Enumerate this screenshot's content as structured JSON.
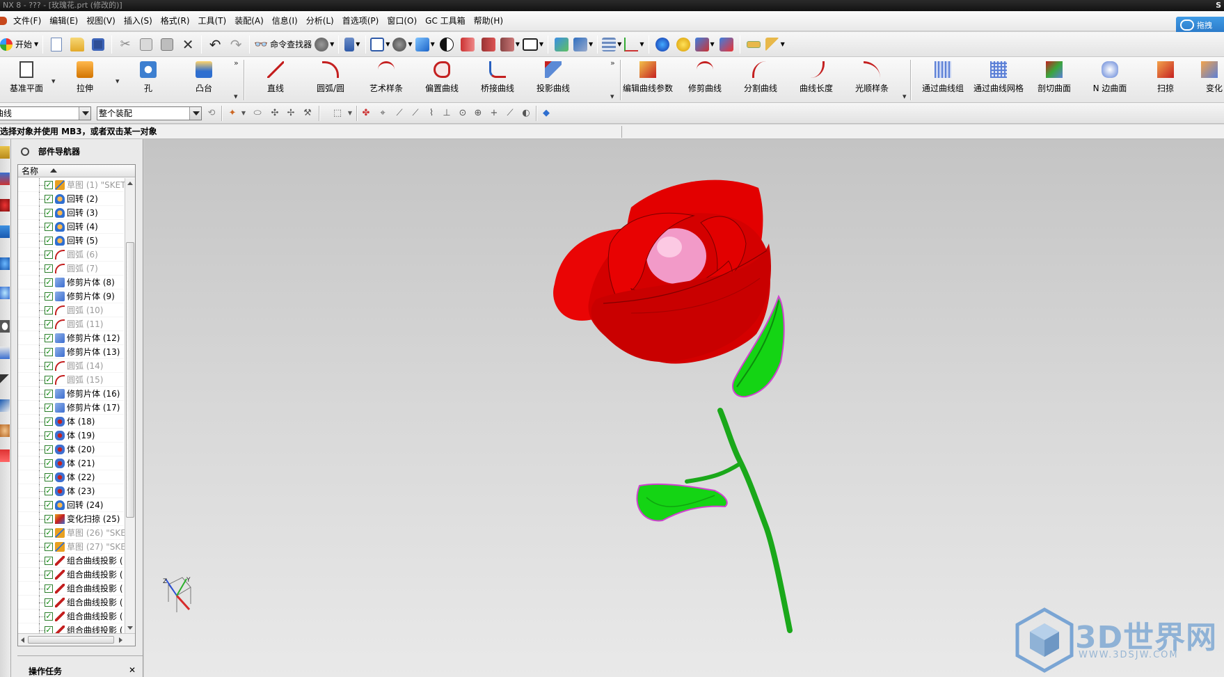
{
  "window": {
    "title": "NX 8 - ??? - [玫瑰花.prt (修改的)]",
    "corner_letter": "S"
  },
  "menubar": {
    "items": [
      {
        "label": "文件(F)"
      },
      {
        "label": "编辑(E)"
      },
      {
        "label": "视图(V)"
      },
      {
        "label": "插入(S)"
      },
      {
        "label": "格式(R)"
      },
      {
        "label": "工具(T)"
      },
      {
        "label": "装配(A)"
      },
      {
        "label": "信息(I)"
      },
      {
        "label": "分析(L)"
      },
      {
        "label": "首选项(P)"
      },
      {
        "label": "窗口(O)"
      },
      {
        "label": "GC 工具箱"
      },
      {
        "label": "帮助(H)"
      }
    ],
    "help_button": "拖拽"
  },
  "toolbar_standard": {
    "start_label": "开始",
    "command_finder_label": "命令查找器",
    "icons": [
      "new-file-icon",
      "open-folder-icon",
      "save-icon",
      "cut-icon",
      "copy-icon",
      "paste-icon",
      "delete-icon",
      "undo-icon",
      "redo-icon"
    ]
  },
  "toolbar_features": {
    "buttons": [
      {
        "label": "基准平面",
        "icon": "datum-plane-icon"
      },
      {
        "label": "拉伸",
        "icon": "extrude-icon"
      },
      {
        "label": "孔",
        "icon": "hole-icon"
      },
      {
        "label": "凸台",
        "icon": "boss-icon"
      },
      {
        "label": "直线",
        "icon": "line-icon"
      },
      {
        "label": "圆弧/圆",
        "icon": "arc-icon"
      },
      {
        "label": "艺术样条",
        "icon": "studio-spline-icon"
      },
      {
        "label": "偏置曲线",
        "icon": "offset-curve-icon"
      },
      {
        "label": "桥接曲线",
        "icon": "bridge-curve-icon"
      },
      {
        "label": "投影曲线",
        "icon": "project-curve-icon"
      },
      {
        "label": "编辑曲线参数",
        "icon": "edit-curve-params-icon"
      },
      {
        "label": "修剪曲线",
        "icon": "trim-curve-icon"
      },
      {
        "label": "分割曲线",
        "icon": "divide-curve-icon"
      },
      {
        "label": "曲线长度",
        "icon": "curve-length-icon"
      },
      {
        "label": "光顺样条",
        "icon": "fair-spline-icon"
      },
      {
        "label": "通过曲线组",
        "icon": "through-curves-icon"
      },
      {
        "label": "通过曲线网格",
        "icon": "through-curve-mesh-icon"
      },
      {
        "label": "剖切曲面",
        "icon": "section-surface-icon"
      },
      {
        "label": "N 边曲面",
        "icon": "n-sided-surface-icon"
      },
      {
        "label": "扫掠",
        "icon": "swept-icon"
      },
      {
        "label": "变化",
        "icon": "variational-sweep-icon"
      }
    ]
  },
  "selection_bar": {
    "filter_value": "曲线",
    "scope_value": "整个装配"
  },
  "cue_line": "选择对象并使用 MB3，或者双击某一对象",
  "part_navigator": {
    "title": "部件导航器",
    "column_name": "名称",
    "rows": [
      {
        "label": "草图 (1) \"SKET",
        "dim": true,
        "icon": "sketch-icon"
      },
      {
        "label": "回转 (2)",
        "dim": false,
        "icon": "revolve-icon"
      },
      {
        "label": "回转 (3)",
        "dim": false,
        "icon": "revolve-icon"
      },
      {
        "label": "回转 (4)",
        "dim": false,
        "icon": "revolve-icon"
      },
      {
        "label": "回转 (5)",
        "dim": false,
        "icon": "revolve-icon"
      },
      {
        "label": "圆弧 (6)",
        "dim": true,
        "icon": "arc-icon"
      },
      {
        "label": "圆弧 (7)",
        "dim": true,
        "icon": "arc-icon"
      },
      {
        "label": "修剪片体 (8)",
        "dim": false,
        "icon": "trim-sheet-icon"
      },
      {
        "label": "修剪片体 (9)",
        "dim": false,
        "icon": "trim-sheet-icon"
      },
      {
        "label": "圆弧 (10)",
        "dim": true,
        "icon": "arc-icon"
      },
      {
        "label": "圆弧 (11)",
        "dim": true,
        "icon": "arc-icon"
      },
      {
        "label": "修剪片体 (12)",
        "dim": false,
        "icon": "trim-sheet-icon"
      },
      {
        "label": "修剪片体 (13)",
        "dim": false,
        "icon": "trim-sheet-icon"
      },
      {
        "label": "圆弧 (14)",
        "dim": true,
        "icon": "arc-icon"
      },
      {
        "label": "圆弧 (15)",
        "dim": true,
        "icon": "arc-icon"
      },
      {
        "label": "修剪片体 (16)",
        "dim": false,
        "icon": "trim-sheet-icon"
      },
      {
        "label": "修剪片体 (17)",
        "dim": false,
        "icon": "trim-sheet-icon"
      },
      {
        "label": "体 (18)",
        "dim": false,
        "icon": "body-icon"
      },
      {
        "label": "体 (19)",
        "dim": false,
        "icon": "body-icon"
      },
      {
        "label": "体 (20)",
        "dim": false,
        "icon": "body-icon"
      },
      {
        "label": "体 (21)",
        "dim": false,
        "icon": "body-icon"
      },
      {
        "label": "体 (22)",
        "dim": false,
        "icon": "body-icon"
      },
      {
        "label": "体 (23)",
        "dim": false,
        "icon": "body-icon"
      },
      {
        "label": "回转 (24)",
        "dim": false,
        "icon": "revolve-icon"
      },
      {
        "label": "变化扫掠 (25)",
        "dim": false,
        "icon": "variational-sweep-icon"
      },
      {
        "label": "草图 (26) \"SKE",
        "dim": true,
        "icon": "sketch-icon"
      },
      {
        "label": "草图 (27) \"SKE",
        "dim": true,
        "icon": "sketch-icon"
      },
      {
        "label": "组合曲线投影 (",
        "dim": false,
        "icon": "combined-projection-icon"
      },
      {
        "label": "组合曲线投影 (",
        "dim": false,
        "icon": "combined-projection-icon"
      },
      {
        "label": "组合曲线投影 (",
        "dim": false,
        "icon": "combined-projection-icon"
      },
      {
        "label": "组合曲线投影 (",
        "dim": false,
        "icon": "combined-projection-icon"
      },
      {
        "label": "组合曲线投影 (",
        "dim": false,
        "icon": "combined-projection-icon"
      },
      {
        "label": "组合曲线投影 (",
        "dim": false,
        "icon": "combined-projection-icon"
      },
      {
        "label": "组合曲线投影 (",
        "dim": false,
        "icon": "combined-projection-icon"
      }
    ],
    "bottom_panel_title": "操作任务"
  },
  "graphics": {
    "model": "rose",
    "colors": {
      "petal": "#e00000",
      "petal_dark": "#a80000",
      "bud": "#f29ac8",
      "leaf": "#14d414",
      "edge": "#d040d0",
      "stem": "#1aa81a"
    }
  },
  "watermark": {
    "brand": "3D世界网",
    "url": "WWW.3DSJW.COM"
  }
}
